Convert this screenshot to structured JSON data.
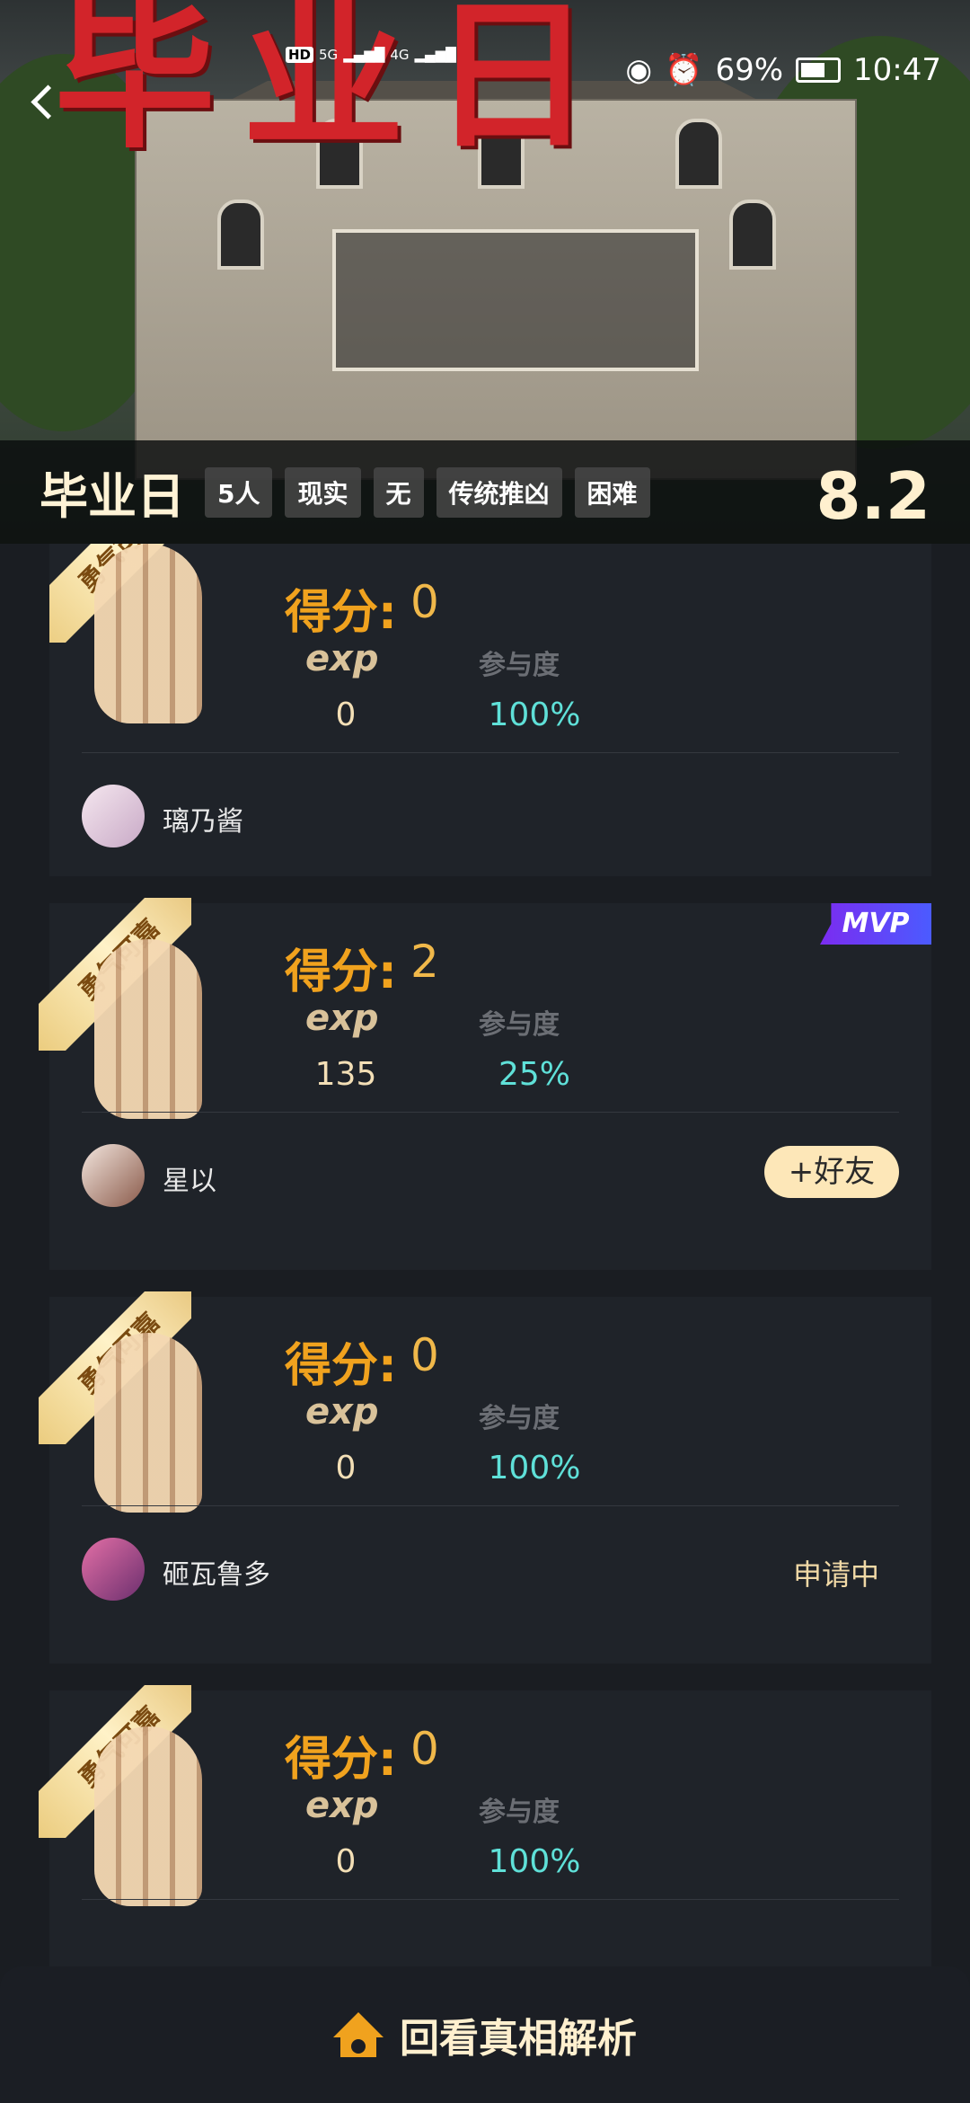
{
  "hero": {
    "big_title": "毕业日",
    "status": {
      "time": "10:47",
      "battery": "69%",
      "net1": "HD",
      "net2": "5G",
      "net3": "4G"
    },
    "info": {
      "name": "毕业日",
      "tags": [
        "5人",
        "现实",
        "无",
        "传统推凶",
        "困难"
      ],
      "score": "8.2"
    }
  },
  "cards": [
    {
      "badge": "勇气可嘉",
      "score_label": "得分:",
      "score": "0",
      "exp_label": "exp",
      "part_label": "参与度",
      "exp": "0",
      "part": "100%",
      "user": "璃乃酱",
      "action": "",
      "mvp": ""
    },
    {
      "badge": "勇气可嘉",
      "score_label": "得分:",
      "score": "2",
      "exp_label": "exp",
      "part_label": "参与度",
      "exp": "135",
      "part": "25%",
      "user": "星以",
      "action": "+好友",
      "mvp": "MVP"
    },
    {
      "badge": "勇气可嘉",
      "score_label": "得分:",
      "score": "0",
      "exp_label": "exp",
      "part_label": "参与度",
      "exp": "0",
      "part": "100%",
      "user": "砸瓦鲁多",
      "action": "申请中",
      "mvp": ""
    },
    {
      "badge": "勇气可嘉",
      "score_label": "得分:",
      "score": "0",
      "exp_label": "exp",
      "part_label": "参与度",
      "exp": "0",
      "part": "100%",
      "user": "",
      "action": "",
      "mvp": ""
    }
  ],
  "bottom": {
    "label": "回看真相解析",
    "icon": "house-icon"
  },
  "colors": {
    "accent": "#f0a21e",
    "teal": "#5fe0d8",
    "title_red": "#d2242a"
  }
}
